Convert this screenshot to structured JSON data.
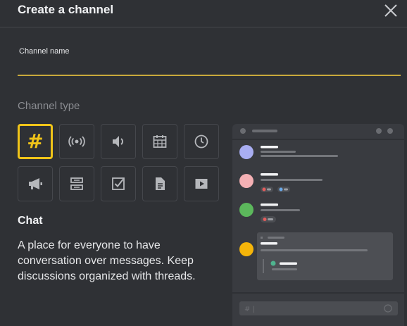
{
  "dialog": {
    "title": "Create a channel"
  },
  "form": {
    "channel_name_label": "Channel name",
    "channel_name_value": "",
    "channel_type_label": "Channel type"
  },
  "channel_types": [
    {
      "name": "chat",
      "icon": "hash-icon",
      "selected": true
    },
    {
      "name": "audio",
      "icon": "broadcast-icon",
      "selected": false
    },
    {
      "name": "voice",
      "icon": "speaker-icon",
      "selected": false
    },
    {
      "name": "calendar",
      "icon": "calendar-icon",
      "selected": false
    },
    {
      "name": "clock",
      "icon": "clock-icon",
      "selected": false
    },
    {
      "name": "announcement",
      "icon": "megaphone-icon",
      "selected": false
    },
    {
      "name": "forum",
      "icon": "forum-icon",
      "selected": false
    },
    {
      "name": "tasks",
      "icon": "checkbox-icon",
      "selected": false
    },
    {
      "name": "docs",
      "icon": "document-icon",
      "selected": false
    },
    {
      "name": "media",
      "icon": "play-icon",
      "selected": false
    }
  ],
  "selected_type": {
    "title": "Chat",
    "description": "A place for everyone to have conversation over messages. Keep discussions organized with threads."
  },
  "preview": {
    "composer_prefix": "# |"
  },
  "colors": {
    "background": "#2f3135",
    "accent": "#f0c419",
    "input_underline": "#c9a93b",
    "preview_bg": "#393b40",
    "avatar_purple": "#a9aef2",
    "avatar_pink": "#f4b0b4",
    "avatar_green": "#5cb85c",
    "avatar_yellow": "#f5b50a"
  }
}
